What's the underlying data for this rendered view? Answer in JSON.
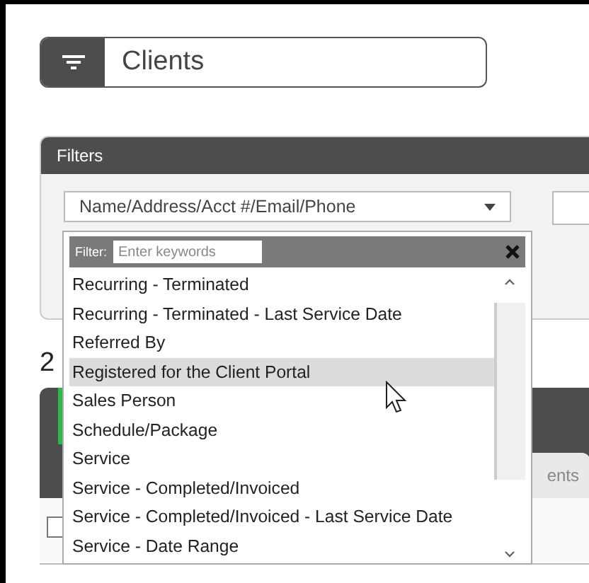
{
  "header": {
    "title": "Clients"
  },
  "filters": {
    "title": "Filters",
    "field": {
      "value": "Name/Address/Acct #/Email/Phone"
    }
  },
  "dropdown": {
    "filter_label": "Filter:",
    "placeholder": "Enter keywords",
    "items": [
      {
        "label": "Recurring - Terminated",
        "selected": false
      },
      {
        "label": "Recurring - Terminated - Last Service Date",
        "selected": false
      },
      {
        "label": "Referred By",
        "selected": false
      },
      {
        "label": "Registered for the Client Portal",
        "selected": true
      },
      {
        "label": "Sales Person",
        "selected": false
      },
      {
        "label": "Schedule/Package",
        "selected": false
      },
      {
        "label": "Service",
        "selected": false
      },
      {
        "label": "Service - Completed/Invoiced",
        "selected": false
      },
      {
        "label": "Service - Completed/Invoiced - Last Service Date",
        "selected": false
      },
      {
        "label": "Service - Date Range",
        "selected": false
      }
    ]
  },
  "behind": {
    "count_text": "2",
    "tab": "ents",
    "checkbox": {
      "checked": false
    }
  }
}
